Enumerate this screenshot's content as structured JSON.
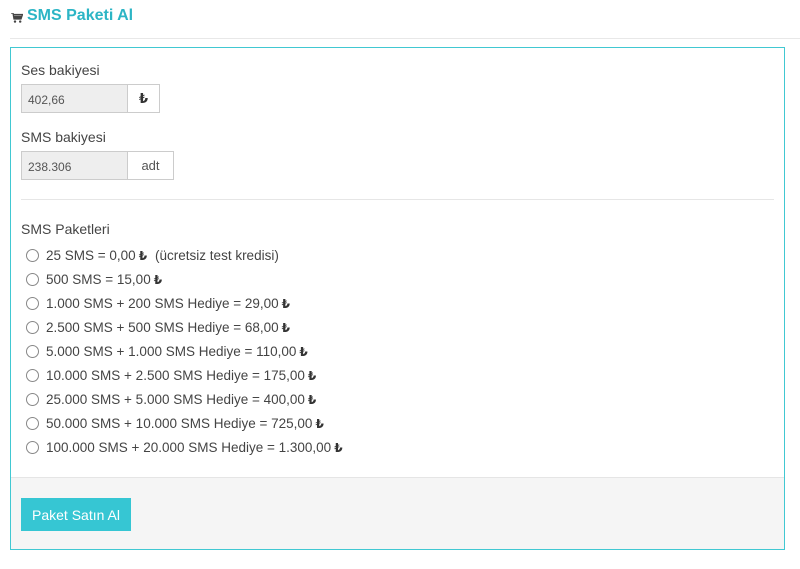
{
  "header": {
    "title": "SMS Paketi Al",
    "icon": "cart-icon"
  },
  "balances": {
    "voice": {
      "label": "Ses bakiyesi",
      "value": "402,66",
      "unit": "₺"
    },
    "sms": {
      "label": "SMS bakiyesi",
      "value": "238.306",
      "unit": "adt"
    }
  },
  "packages": {
    "label": "SMS Paketleri",
    "currency": "₺",
    "items": [
      {
        "text": "25 SMS = 0,00",
        "note": "(ücretsiz test kredisi)"
      },
      {
        "text": "500 SMS = 15,00"
      },
      {
        "text": "1.000 SMS + 200 SMS Hediye = 29,00"
      },
      {
        "text": "2.500 SMS + 500 SMS Hediye = 68,00"
      },
      {
        "text": "5.000 SMS + 1.000 SMS Hediye = 110,00"
      },
      {
        "text": "10.000 SMS + 2.500 SMS Hediye = 175,00"
      },
      {
        "text": "25.000 SMS + 5.000 SMS Hediye = 400,00"
      },
      {
        "text": "50.000 SMS + 10.000 SMS Hediye = 725,00"
      },
      {
        "text": "100.000 SMS + 20.000 SMS Hediye = 1.300,00"
      }
    ]
  },
  "actions": {
    "buy_label": "Paket Satın Al"
  },
  "colors": {
    "accent": "#36c6d3",
    "title": "#2cb5c5",
    "border": "#41c8d2"
  }
}
